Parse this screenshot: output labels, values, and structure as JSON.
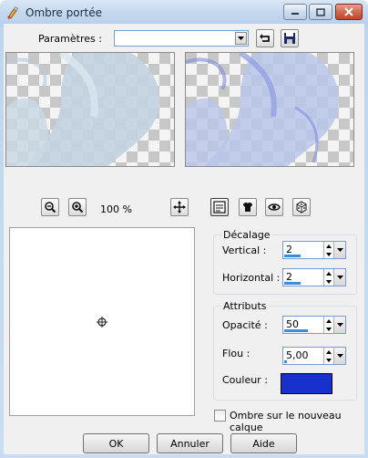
{
  "window": {
    "title": "Ombre portée"
  },
  "presets": {
    "label": "Paramètres :",
    "value": ""
  },
  "zoom": {
    "level": "100 %"
  },
  "offset": {
    "title": "Décalage",
    "vertical": {
      "label": "Vertical :",
      "value": "2",
      "level": 0.35
    },
    "horizontal": {
      "label": "Horizontal :",
      "value": "2",
      "level": 0.35
    }
  },
  "attributes": {
    "title": "Attributs",
    "opacity": {
      "label": "Opacité :",
      "value": "50",
      "level": 0.5
    },
    "blur": {
      "label": "Flou :",
      "value": "5,00",
      "level": 0.05
    },
    "color": {
      "label": "Couleur :",
      "value": "#1631cc"
    }
  },
  "new_layer": {
    "label": "Ombre sur le nouveau calque",
    "checked": false
  },
  "buttons": {
    "ok": "OK",
    "cancel": "Annuler",
    "help": "Aide"
  },
  "icons": {
    "app": "paint-icon",
    "minimize": "minimize-icon",
    "maximize": "maximize-icon",
    "close": "close-icon",
    "reset": "reset-icon",
    "save": "save-icon",
    "zoom_out": "zoom-out-icon",
    "zoom_in": "zoom-in-icon",
    "pan": "pan-icon",
    "preview_mode": "preview-mode-icon",
    "randomize": "dice-icon"
  }
}
